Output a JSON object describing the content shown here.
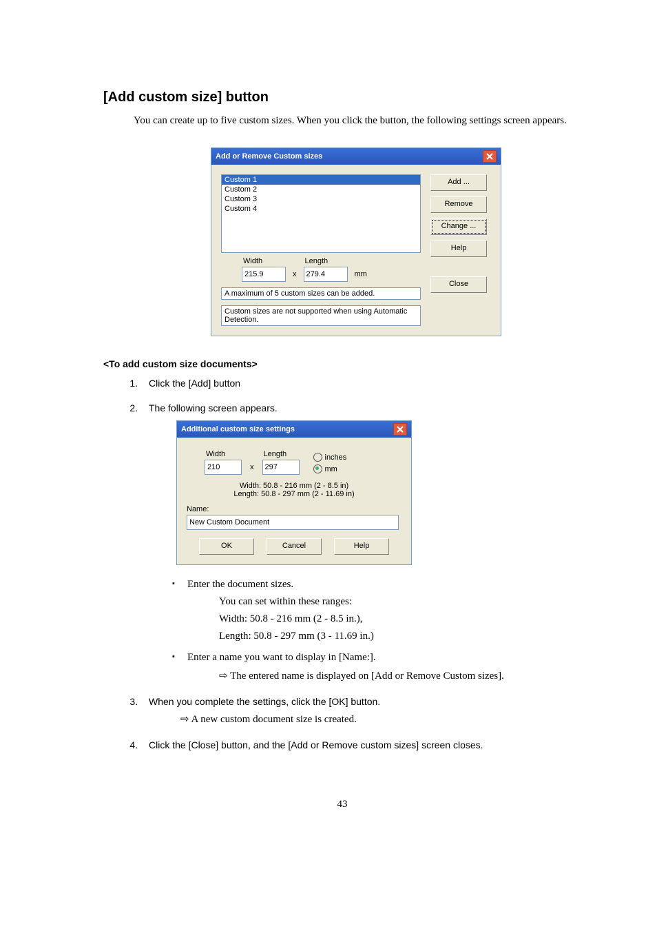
{
  "heading": "[Add custom size] button",
  "intro": "You can create up to five custom sizes. When you click the button, the following settings screen appears.",
  "dlg1": {
    "title": "Add or Remove Custom sizes",
    "items": [
      "Custom 1",
      "Custom 2",
      "Custom 3",
      "Custom 4"
    ],
    "width_label": "Width",
    "length_label": "Length",
    "width_value": "215.9",
    "length_value": "279.4",
    "x": "x",
    "unit": "mm",
    "info1": "A maximum of 5 custom sizes can be added.",
    "info2": "Custom sizes are not supported when using Automatic Detection.",
    "buttons": {
      "add": "Add ...",
      "remove": "Remove",
      "change": "Change ...",
      "help": "Help",
      "close": "Close"
    }
  },
  "subheading": "<To add custom size documents>",
  "steps": {
    "s1": "Click the [Add] button",
    "s2": "The following screen appears.",
    "s3": "When you complete the settings, click the [OK] button.",
    "s3_sub": "A new custom document size is created.",
    "s4": "Click the [Close] button, and the [Add or Remove custom sizes] screen closes."
  },
  "dlg2": {
    "title": "Additional custom size settings",
    "width_label": "Width",
    "length_label": "Length",
    "width_value": "210",
    "length_value": "297",
    "x": "x",
    "inches": "inches",
    "mm": "mm",
    "range_w": "Width: 50.8 - 216 mm  (2 - 8.5 in)",
    "range_l": "Length: 50.8 - 297 mm  (2 - 11.69 in)",
    "name_label": "Name:",
    "name_value": "New Custom Document",
    "buttons": {
      "ok": "OK",
      "cancel": "Cancel",
      "help": "Help"
    }
  },
  "bullets": {
    "b1": "Enter the document sizes.",
    "b1_a": "You can set within these ranges:",
    "b1_b": "Width: 50.8 - 216 mm (2 - 8.5 in.),",
    "b1_c": "Length: 50.8 - 297 mm (3 - 11.69 in.)",
    "b2": "Enter a name you want to display in [Name:].",
    "b2_sub": "The entered name is displayed on [Add or Remove Custom sizes]."
  },
  "page_number": "43"
}
